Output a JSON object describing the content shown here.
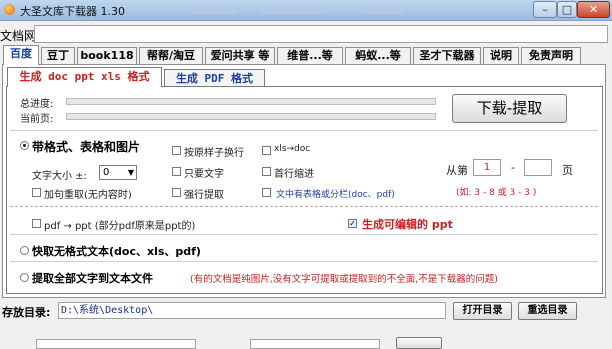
{
  "window": {
    "title": "大圣文库下载器 1.30",
    "controls": {
      "minimize": "–",
      "maximize": "□",
      "close": "✕"
    }
  },
  "url": {
    "label": "文档网址:",
    "value": ""
  },
  "tabs": [
    {
      "label": "百度"
    },
    {
      "label": "豆丁"
    },
    {
      "label": "book118"
    },
    {
      "label": "帮帮/淘豆"
    },
    {
      "label": "爱问共享 等"
    },
    {
      "label": "维普...等"
    },
    {
      "label": "蚂蚁...等"
    },
    {
      "label": "圣才下载器"
    },
    {
      "label": "说明"
    },
    {
      "label": "免责声明"
    }
  ],
  "subtabs": [
    {
      "label": "生成 doc ppt xls 格式"
    },
    {
      "label": "生成 PDF 格式"
    }
  ],
  "progress": {
    "total_label": "总进度:",
    "current_label": "当前页:",
    "total_value": 0,
    "current_value": 0
  },
  "download_button": "下载-提取",
  "options": {
    "formatted": "带格式、表格和图片",
    "font_size_label": "文字大小 ±:",
    "font_size_value": "0",
    "retry": "加句重取(无内容时)",
    "by_sample": "按原样子换行",
    "text_only": "只要文字",
    "force_extract": "强行提取",
    "xls_to_doc": "xls→doc",
    "first_indent": "首行缩进",
    "table_note": "文中有表格或分栏(doc、pdf)",
    "page_from_label": "从第",
    "page_from": "1",
    "page_dash": "-",
    "page_to": "",
    "page_unit": "页",
    "page_hint": "(如: 3 - 8  或 3 - 3 )",
    "pdf_to_ppt": "pdf → ppt (部分pdf原来是ppt的)",
    "editable_ppt": "生成可编辑的 ppt",
    "quick_text": "快取无格式文本(doc、xls、pdf)",
    "extract_all": "提取全部文字到文本文件",
    "extract_note": "(有的文档是纯图片,没有文字可提取或提取到的不全面,不是下载器的问题)"
  },
  "save": {
    "label": "存放目录:",
    "path": "D:\\系统\\Desktop\\",
    "open_button": "打开目录",
    "reselect_button": "重选目录"
  },
  "colors": {
    "accent_red": "#cc2020",
    "accent_blue": "#1a3fa8",
    "title_bar": "#a8c4e6"
  }
}
